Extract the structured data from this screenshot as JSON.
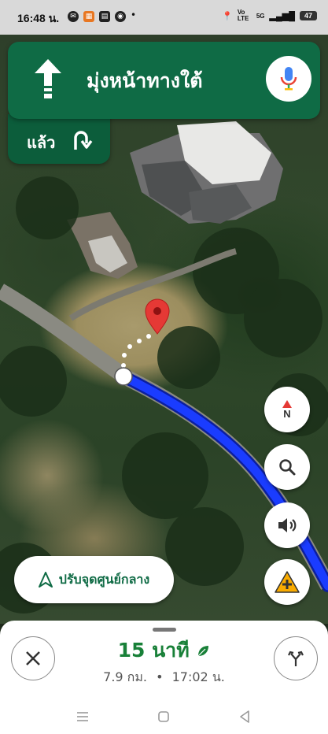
{
  "status_bar": {
    "time": "16:48 น.",
    "network": "Vo LTE",
    "signal": "5G",
    "battery": "47"
  },
  "navigation": {
    "instruction": "มุ่งหน้าทางใต้",
    "then_label": "แล้ว"
  },
  "map_controls": {
    "compass_label": "N"
  },
  "recenter": {
    "label": "ปรับจุดศูนย์กลาง"
  },
  "trip": {
    "minutes": "15 นาที",
    "distance": "7.9 กม.",
    "separator": "•",
    "arrival": "17:02 น."
  },
  "colors": {
    "banner": "#0f6b45",
    "route": "#1a3cff",
    "eta": "#188038",
    "pin": "#e53935"
  }
}
